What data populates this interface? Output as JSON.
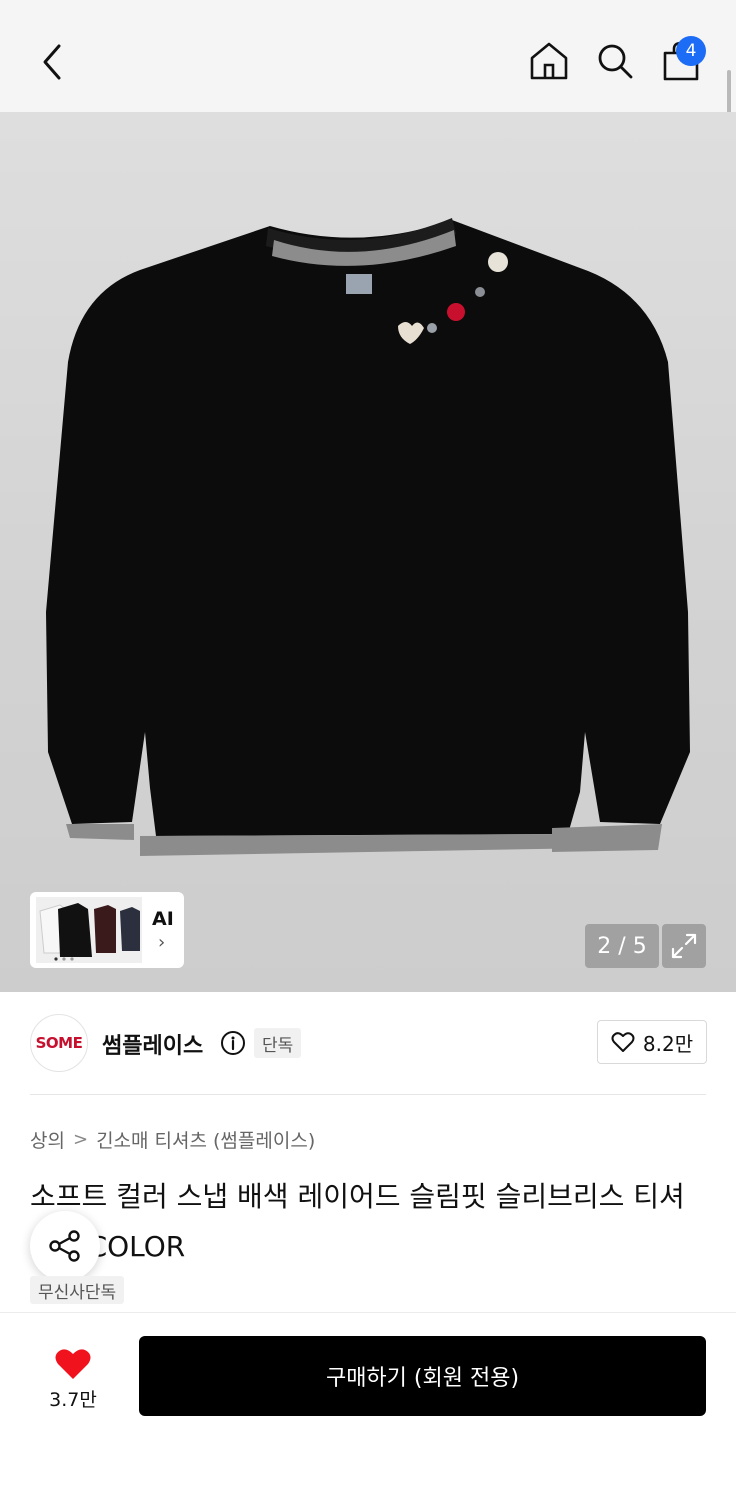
{
  "header": {
    "cart_count": "4"
  },
  "gallery": {
    "ai_label": "AI",
    "ai_chevron": "›",
    "counter": "2 / 5"
  },
  "brand": {
    "logo_text": "SOME",
    "name": "썸플레이스",
    "badge": "단독",
    "likes": "8.2만"
  },
  "product": {
    "breadcrumb": [
      "상의",
      "긴소매 티셔츠 (썸플레이스)"
    ],
    "breadcrumb_sep": ">",
    "title": "소프트 컬러 스냅 배색 레이어드 슬림핏 슬리브리스 티셔츠_2COLOR",
    "tag": "무신사단독"
  },
  "bottom": {
    "like_count": "3.7만",
    "buy_label": "구매하기 (회원 전용)"
  },
  "icons": {
    "back": "chevron-left-icon",
    "home": "home-icon",
    "search": "search-icon",
    "cart": "shopping-bag-icon",
    "info": "info-icon",
    "heart": "heart-icon",
    "share": "share-icon",
    "expand": "expand-icon"
  },
  "colors": {
    "badge_blue": "#1d6cf5",
    "brand_red": "#c7102e",
    "heart_red": "#f0131e",
    "buy_black": "#000000"
  }
}
